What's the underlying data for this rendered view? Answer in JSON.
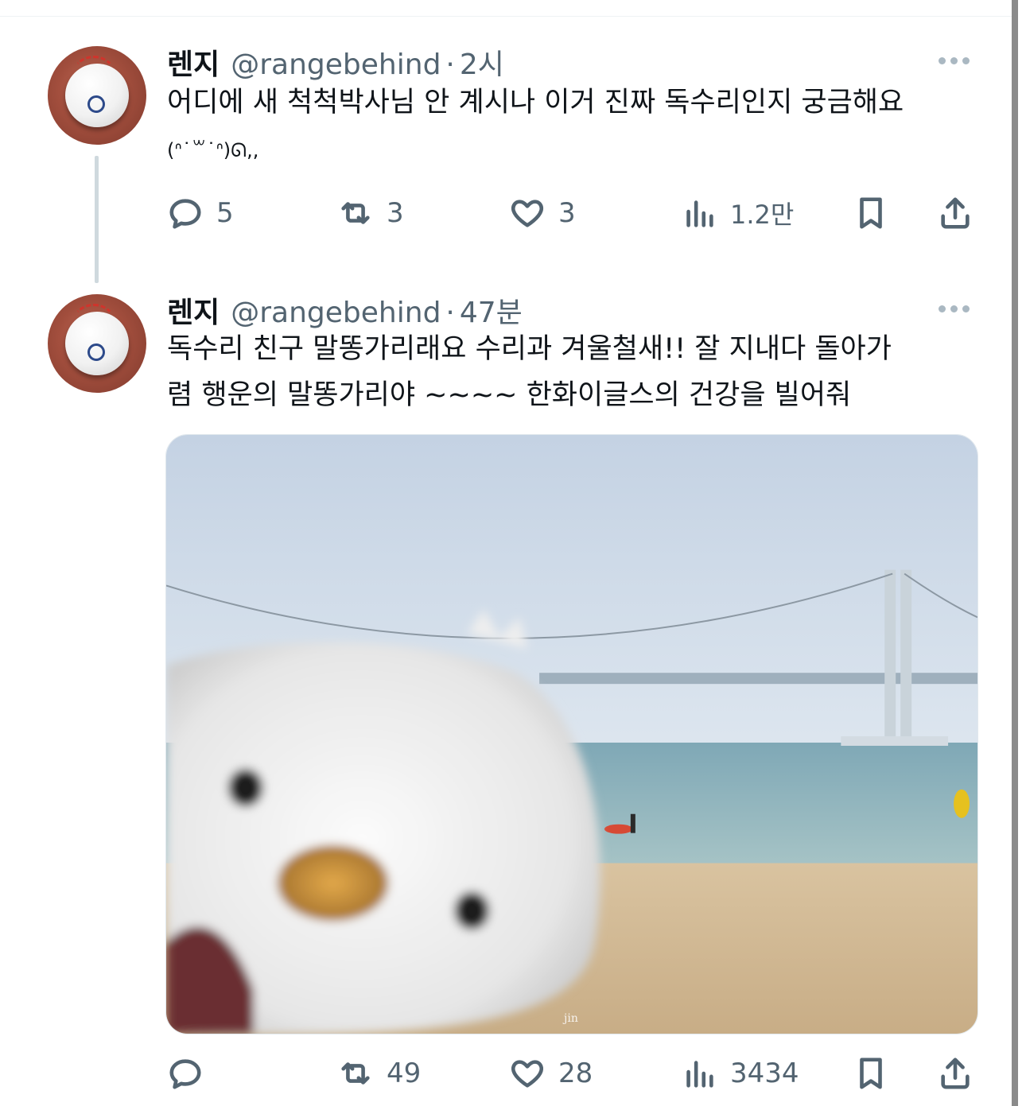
{
  "tweets": [
    {
      "display_name": "렌지",
      "handle": "@rangebehind",
      "separator": "·",
      "time": "2시",
      "text_line1": "어디에 새 척척박사님 안 계시나 이거 진짜 독수리인지 궁금해요",
      "text_line2": "(ᐢ˙꒳˙ᐢ)ᘏ,,",
      "actions": {
        "replies": "5",
        "retweets": "3",
        "likes": "3",
        "views": "1.2만"
      }
    },
    {
      "display_name": "렌지",
      "handle": "@rangebehind",
      "separator": "·",
      "time": "47분",
      "text_line1": "독수리 친구 말똥가리래요 수리과 겨울철새!! 잘 지내다 돌아가",
      "text_line2": "렴 행운의 말똥가리야 ~~~~ 한화이글스의 건강을 빌어줘",
      "media_watermark": "jin",
      "actions": {
        "replies": "",
        "retweets": "49",
        "likes": "28",
        "views": "3434"
      }
    }
  ],
  "icons": [
    "reply-icon",
    "retweet-icon",
    "like-icon",
    "views-icon",
    "bookmark-icon",
    "share-icon",
    "more-icon"
  ],
  "colors": {
    "text": "#0f1419",
    "secondary": "#536471",
    "thread_line": "#cfd9de"
  }
}
